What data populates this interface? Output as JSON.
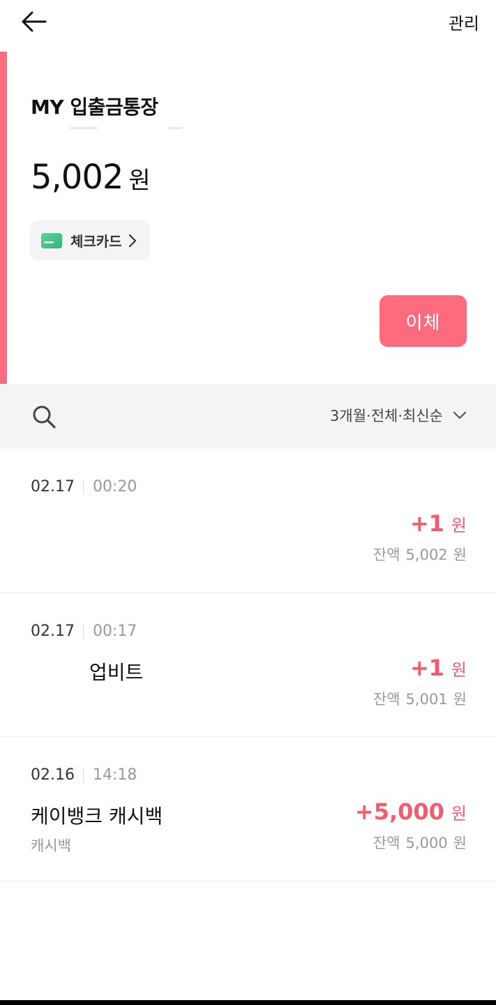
{
  "header": {
    "back_icon": "arrow-left-icon",
    "manage_label": "관리"
  },
  "account": {
    "name": "MY 입출금통장",
    "balance": "5,002",
    "balance_unit": "원",
    "card_chip_label": "체크카드",
    "card_icon": "credit-card-icon",
    "transfer_label": "이체",
    "accent_color": "#ff6b7e"
  },
  "filter": {
    "search_icon": "search-icon",
    "label": "3개월·전체·최신순",
    "chevron_icon": "chevron-down-icon"
  },
  "transactions": [
    {
      "date": "02.17",
      "time": "00:20",
      "title": "",
      "subtitle": "",
      "amount": "+1",
      "amount_unit": "원",
      "balance_label": "잔액",
      "balance": "5,002",
      "balance_unit": "원"
    },
    {
      "date": "02.17",
      "time": "00:17",
      "title": "업비트",
      "subtitle": "",
      "amount": "+1",
      "amount_unit": "원",
      "balance_label": "잔액",
      "balance": "5,001",
      "balance_unit": "원"
    },
    {
      "date": "02.16",
      "time": "14:18",
      "title": "케이뱅크 캐시백",
      "subtitle": "캐시백",
      "amount": "+5,000",
      "amount_unit": "원",
      "balance_label": "잔액",
      "balance": "5,000",
      "balance_unit": "원"
    }
  ],
  "colors": {
    "accent": "#ff6b7e",
    "amount_positive": "#f45b6f",
    "filter_bg": "#f4f4f4"
  }
}
